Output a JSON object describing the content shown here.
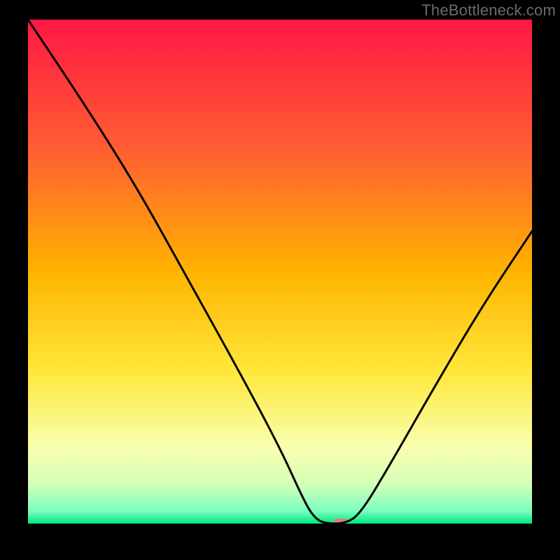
{
  "watermark": "TheBottleneck.com",
  "chart_data": {
    "type": "line",
    "title": "",
    "xlabel": "",
    "ylabel": "",
    "xlim": [
      0,
      100
    ],
    "ylim": [
      0,
      100
    ],
    "annotations": [
      {
        "type": "marker",
        "x": 62,
        "y": 0,
        "color": "#e47a7a",
        "shape": "pill"
      }
    ],
    "curve": [
      {
        "x": 0,
        "y": 100
      },
      {
        "x": 12,
        "y": 82
      },
      {
        "x": 22,
        "y": 66
      },
      {
        "x": 32,
        "y": 48
      },
      {
        "x": 42,
        "y": 30
      },
      {
        "x": 50,
        "y": 15
      },
      {
        "x": 55,
        "y": 4
      },
      {
        "x": 57,
        "y": 1
      },
      {
        "x": 59,
        "y": 0
      },
      {
        "x": 63,
        "y": 0
      },
      {
        "x": 66,
        "y": 2
      },
      {
        "x": 72,
        "y": 12
      },
      {
        "x": 80,
        "y": 26
      },
      {
        "x": 90,
        "y": 43
      },
      {
        "x": 100,
        "y": 58
      }
    ],
    "gradient_stops": [
      {
        "offset": 0,
        "color": "#ff1744"
      },
      {
        "offset": 25,
        "color": "#ff5c33"
      },
      {
        "offset": 50,
        "color": "#ffb300"
      },
      {
        "offset": 70,
        "color": "#ffe83b"
      },
      {
        "offset": 85,
        "color": "#f8ffb0"
      },
      {
        "offset": 92,
        "color": "#d6ffb8"
      },
      {
        "offset": 97.5,
        "color": "#7affbf"
      },
      {
        "offset": 100,
        "color": "#00e682"
      }
    ],
    "curve_color": "#000000",
    "curve_width": 3
  }
}
